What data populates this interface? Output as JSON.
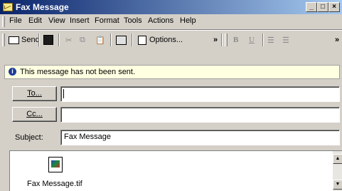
{
  "window": {
    "title": "Fax Message"
  },
  "menu": [
    "File",
    "Edit",
    "View",
    "Insert",
    "Format",
    "Tools",
    "Actions",
    "Help"
  ],
  "toolbar": {
    "send": "Send",
    "options": "Options...",
    "bold": "B",
    "underline": "U",
    "overflow": "»"
  },
  "infobar": {
    "text": "This message has not been sent."
  },
  "fields": {
    "to_button": "To...",
    "to_value": "",
    "cc_button": "Cc...",
    "cc_value": "",
    "subject_label": "Subject:",
    "subject_value": "Fax Message"
  },
  "attachment": {
    "name": "Fax Message.tif"
  }
}
